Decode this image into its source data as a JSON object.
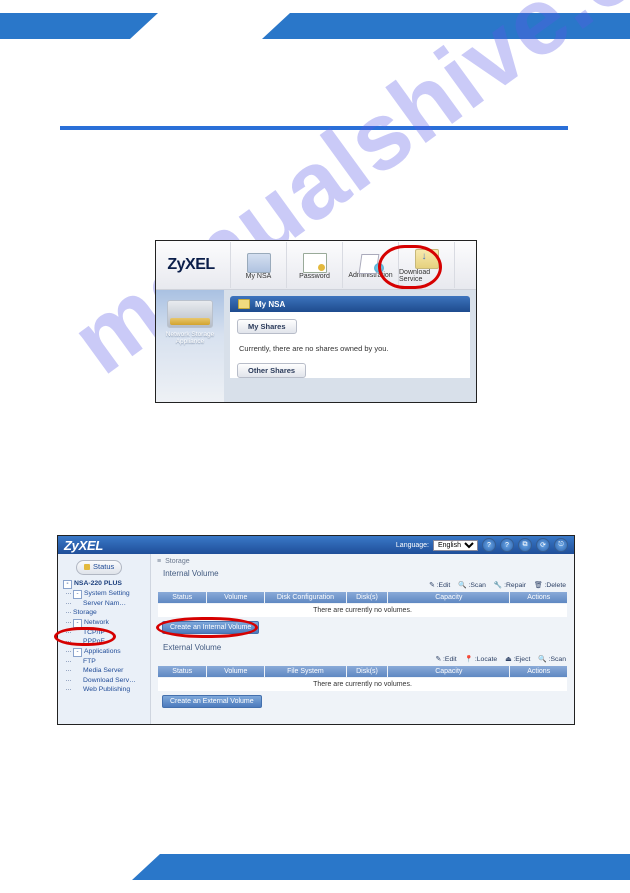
{
  "watermark": "manualshive.com",
  "fig1": {
    "logo": "ZyXEL",
    "buttons": {
      "mynsa": "My NSA",
      "password": "Password",
      "admin": "Administration",
      "download": "Download Service"
    },
    "sidebar_label": "Network Storage Appliance",
    "panel": {
      "title": "My NSA",
      "tab_myshares": "My Shares",
      "message": "Currently, there are no shares owned by you.",
      "tab_othershares": "Other Shares"
    }
  },
  "fig2": {
    "logo": "ZyXEL",
    "language_label": "Language:",
    "language_value": "English",
    "topicons": [
      "?",
      "?",
      "⧉",
      "⟳",
      "⎋"
    ],
    "status_button": "Status",
    "tree": {
      "root": "NSA-220 PLUS",
      "items": [
        {
          "label": "System Setting",
          "box": "-"
        },
        {
          "label": "Server Nam…",
          "indent": true
        },
        {
          "label": "Storage",
          "hl": true
        },
        {
          "label": "Network",
          "box": "-"
        },
        {
          "label": "TCP/IP",
          "indent": true
        },
        {
          "label": "PPPoE",
          "indent": true
        },
        {
          "label": "Applications",
          "box": "-"
        },
        {
          "label": "FTP",
          "indent": true
        },
        {
          "label": "Media Server",
          "indent": true
        },
        {
          "label": "Download Serv…",
          "indent": true
        },
        {
          "label": "Web Publishing",
          "indent": true
        }
      ]
    },
    "crumb_icon": "≡",
    "crumb": "Storage",
    "section1_title": "Internal Volume",
    "actions1": [
      "✎ :Edit",
      "🔍 :Scan",
      "🔧 :Repair",
      "🗑 :Delete"
    ],
    "headers1": [
      "Status",
      "Volume",
      "Disk Configuration",
      "Disk(s)",
      "Capacity",
      "Actions"
    ],
    "novol": "There are currently no volumes.",
    "btn_internal": "Create an Internal Volume",
    "section2_title": "External Volume",
    "actions2": [
      "✎ :Edit",
      "📍 :Locate",
      "⏏ :Eject",
      "🔍 :Scan"
    ],
    "headers2": [
      "Status",
      "Volume",
      "File System",
      "Disk(s)",
      "Capacity",
      "Actions"
    ],
    "btn_external": "Create an External Volume"
  }
}
